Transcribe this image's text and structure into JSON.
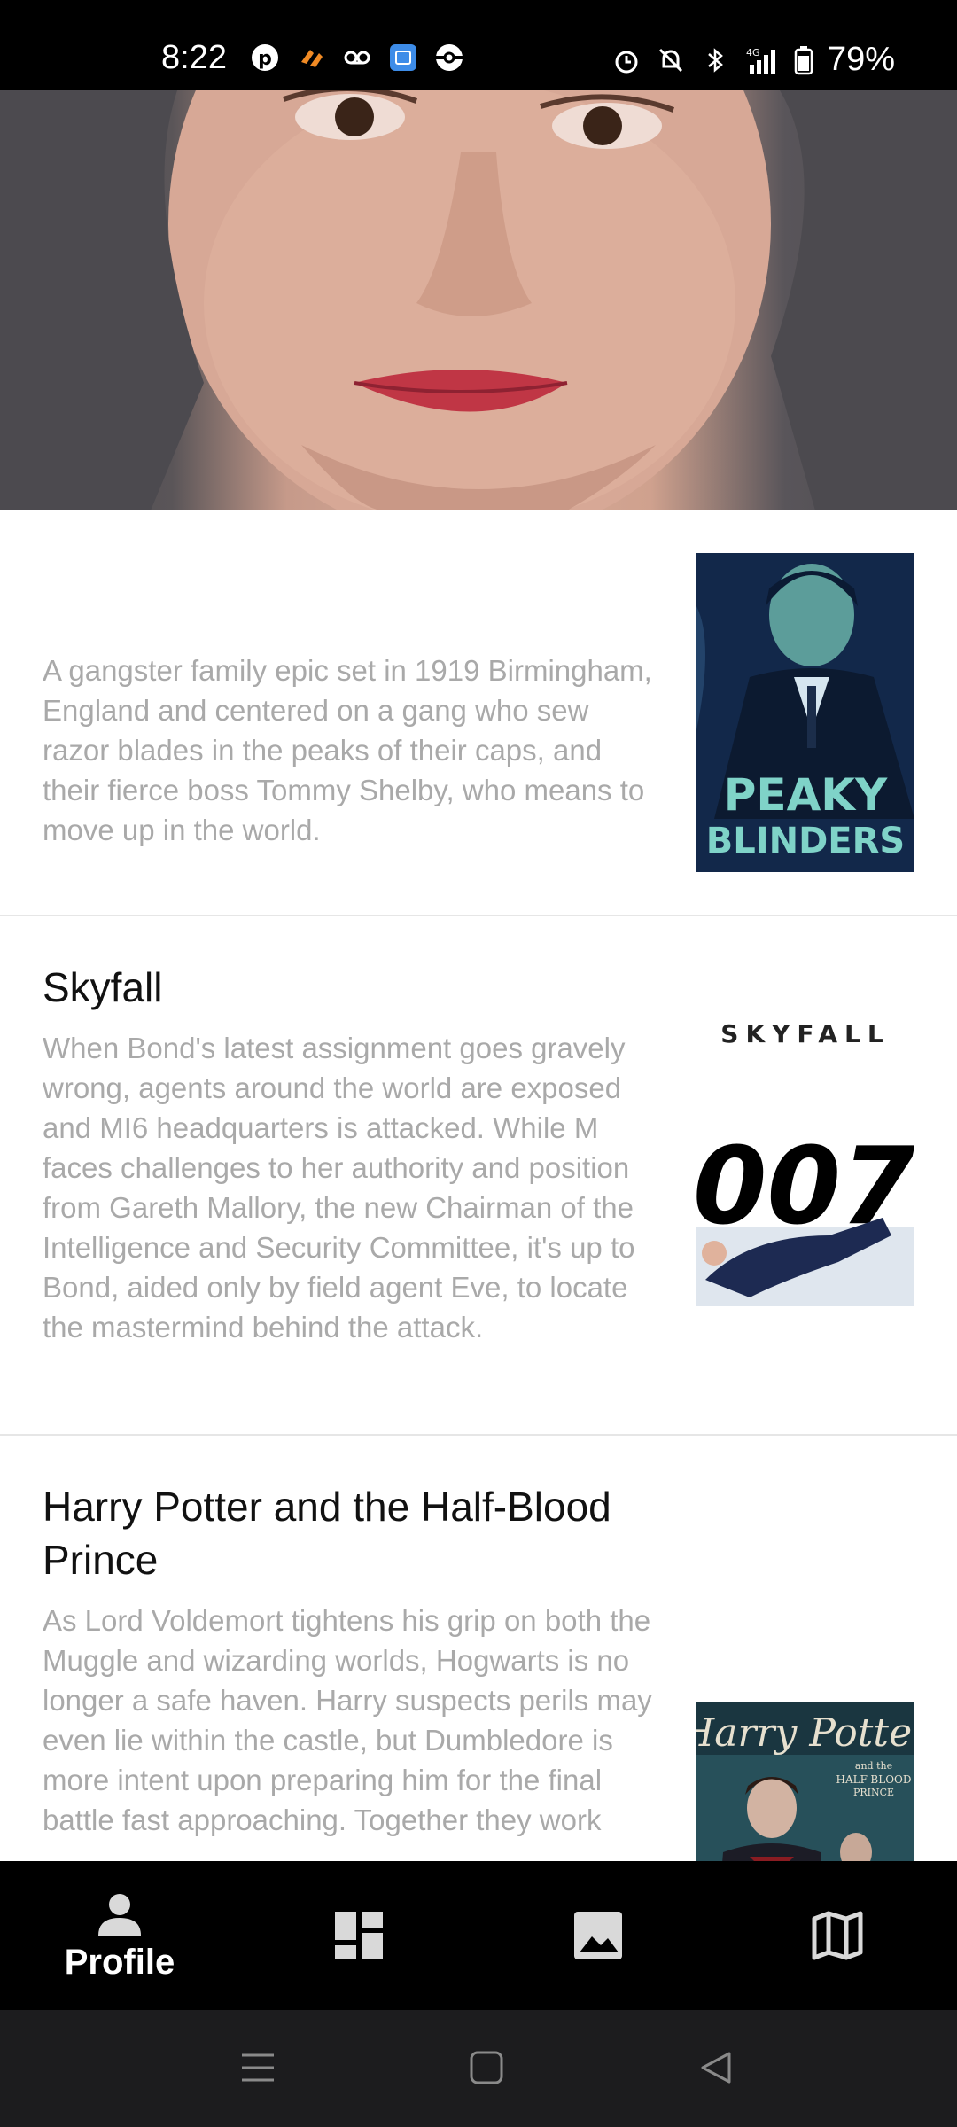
{
  "status_bar": {
    "time": "8:22",
    "battery": "79%",
    "left_icons": [
      "pinterest-icon",
      "app-icon",
      "voicemail-icon",
      "calendar-app-icon",
      "pokeball-icon"
    ],
    "right_icons": [
      "alarm-icon",
      "mute-icon",
      "bluetooth-icon",
      "signal-4g-icon",
      "battery-icon"
    ]
  },
  "movies": [
    {
      "title": "",
      "description": "A gangster family epic set in 1919 Birmingham, England and centered on a gang who sew razor blades in the peaks of their caps, and their fierce boss Tommy Shelby, who means to move up in the world.",
      "poster_text": "PEAKY\nBLINDERS"
    },
    {
      "title": "Skyfall",
      "description": "When Bond's latest assignment goes gravely wrong, agents around the world are exposed and MI6 headquarters is attacked. While M faces challenges to her authority and position from Gareth Mallory, the new Chairman of the Intelligence and Security Committee, it's up to Bond, aided only by field agent Eve, to locate the mastermind behind the attack.",
      "poster_title": "SKYFALL",
      "poster_logo": "007"
    },
    {
      "title": "Harry Potter and the Half-Blood Prince",
      "description": "As Lord Voldemort tightens his grip on both the Muggle and wizarding worlds, Hogwarts is no longer a safe haven. Harry suspects perils may even lie within the castle, but Dumbledore is more intent upon preparing him for the final battle fast approaching. Together they work",
      "poster_title": "Harry Potter",
      "poster_subtitle": "and the\nHALF-BLOOD\nPRINCE"
    }
  ],
  "bottom_nav": {
    "items": [
      {
        "icon": "person-icon",
        "label": "Profile"
      },
      {
        "icon": "dashboard-icon",
        "label": ""
      },
      {
        "icon": "image-icon",
        "label": ""
      },
      {
        "icon": "map-icon",
        "label": ""
      }
    ]
  },
  "colors": {
    "nav_bg": "#000000",
    "sys_nav_bg": "#1c1c1e",
    "desc_text": "#a9a9a9",
    "title_text": "#111111"
  }
}
